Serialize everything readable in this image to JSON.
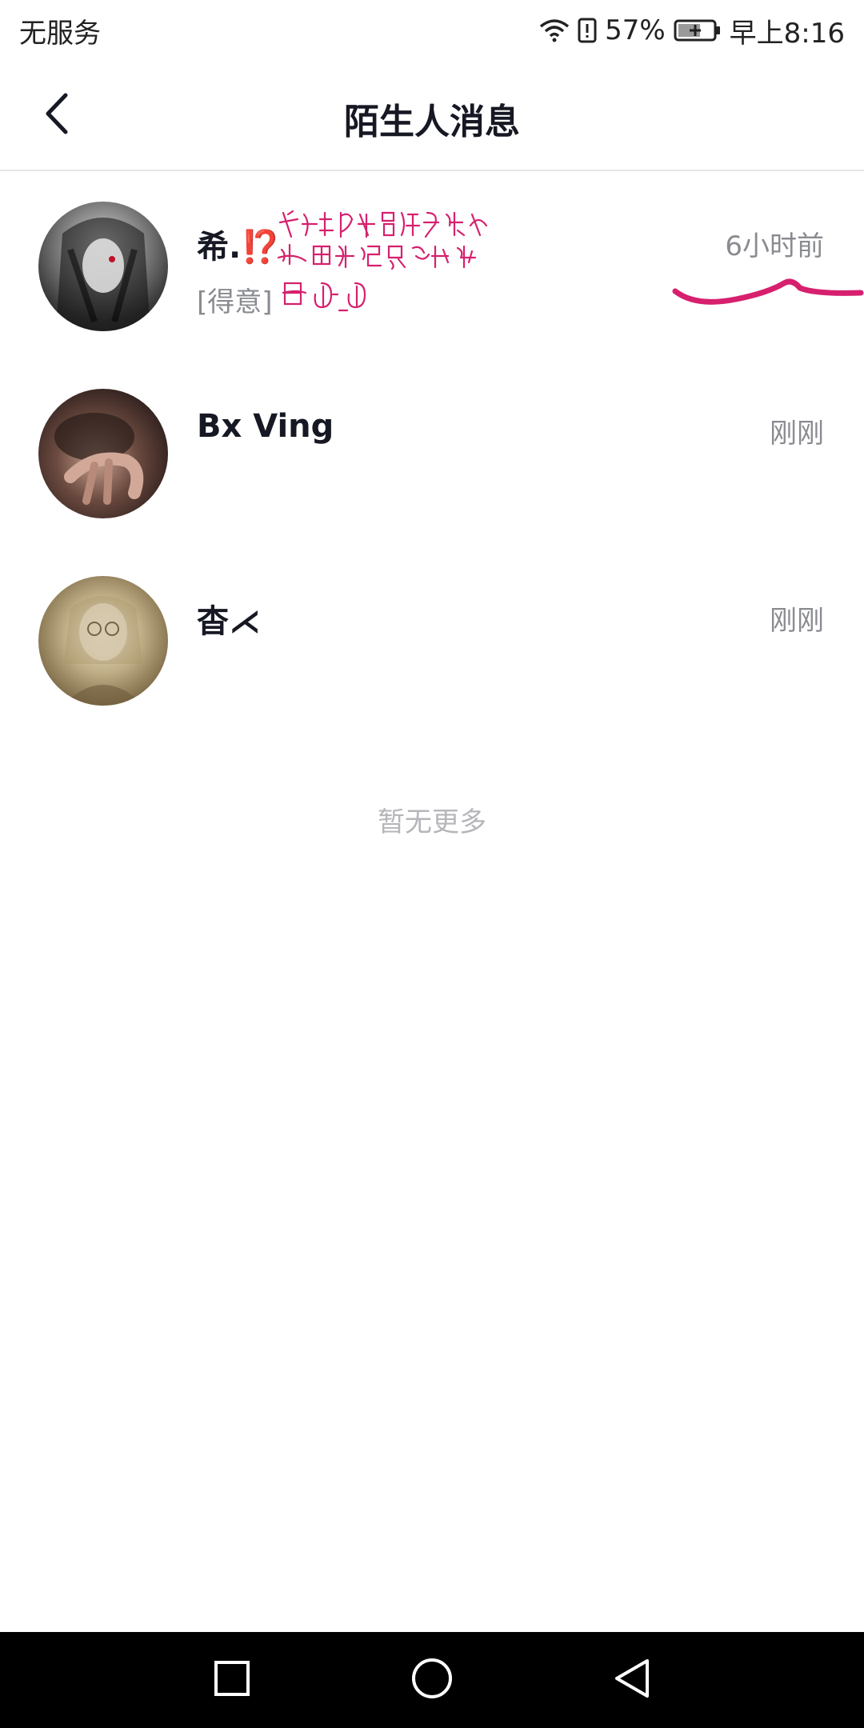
{
  "status_bar": {
    "carrier": "无服务",
    "battery_percent": "57%",
    "time": "早上8:16",
    "icons": [
      "wifi-icon",
      "alert-icon",
      "battery-charging-icon"
    ]
  },
  "header": {
    "title": "陌生人消息",
    "back_icon": "chevron-left-icon"
  },
  "conversations": [
    {
      "name": "希.⁉️",
      "preview": "[得意]",
      "time": "6小时前"
    },
    {
      "name": "Bx  Ving",
      "preview": "",
      "time": "刚刚"
    },
    {
      "name": "杳⋌",
      "preview": "",
      "time": "刚刚"
    }
  ],
  "empty_hint": "暂无更多",
  "system_nav": {
    "icons": [
      "recents-square-icon",
      "home-circle-icon",
      "back-triangle-icon"
    ]
  },
  "colors": {
    "annotation": "#d6206e",
    "secondary_text": "#8a8b91",
    "primary_text": "#161823"
  }
}
